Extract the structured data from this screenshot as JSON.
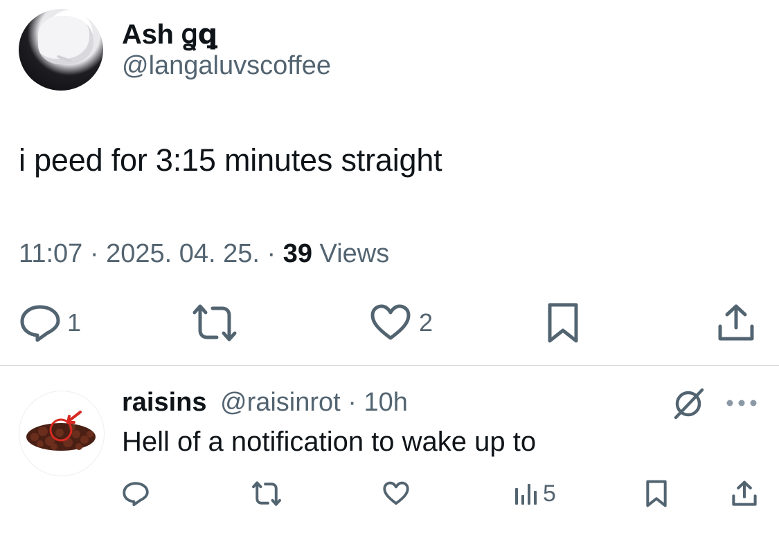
{
  "tweet": {
    "display_name": "Ash ⁤ẞ",
    "display_name_text": "Ash",
    "display_name_glyph": "ꬶꝗ",
    "handle": "@langaluvscoffee",
    "text": "i peed for 3:15 minutes straight",
    "time": "11:07",
    "date": "2025. 04. 25.",
    "views_count": "39",
    "views_label": "Views",
    "replies": "1",
    "likes": "2"
  },
  "reply": {
    "display_name": "raisins",
    "handle": "@raisinrot",
    "age": "10h",
    "text": "Hell of a notification to wake up to",
    "views": "5"
  },
  "colors": {
    "text": "#0f1419",
    "secondary": "#536471",
    "divider": "#d6d9dc",
    "raisin": "#5a2a1c",
    "mark": "#d62a22"
  }
}
